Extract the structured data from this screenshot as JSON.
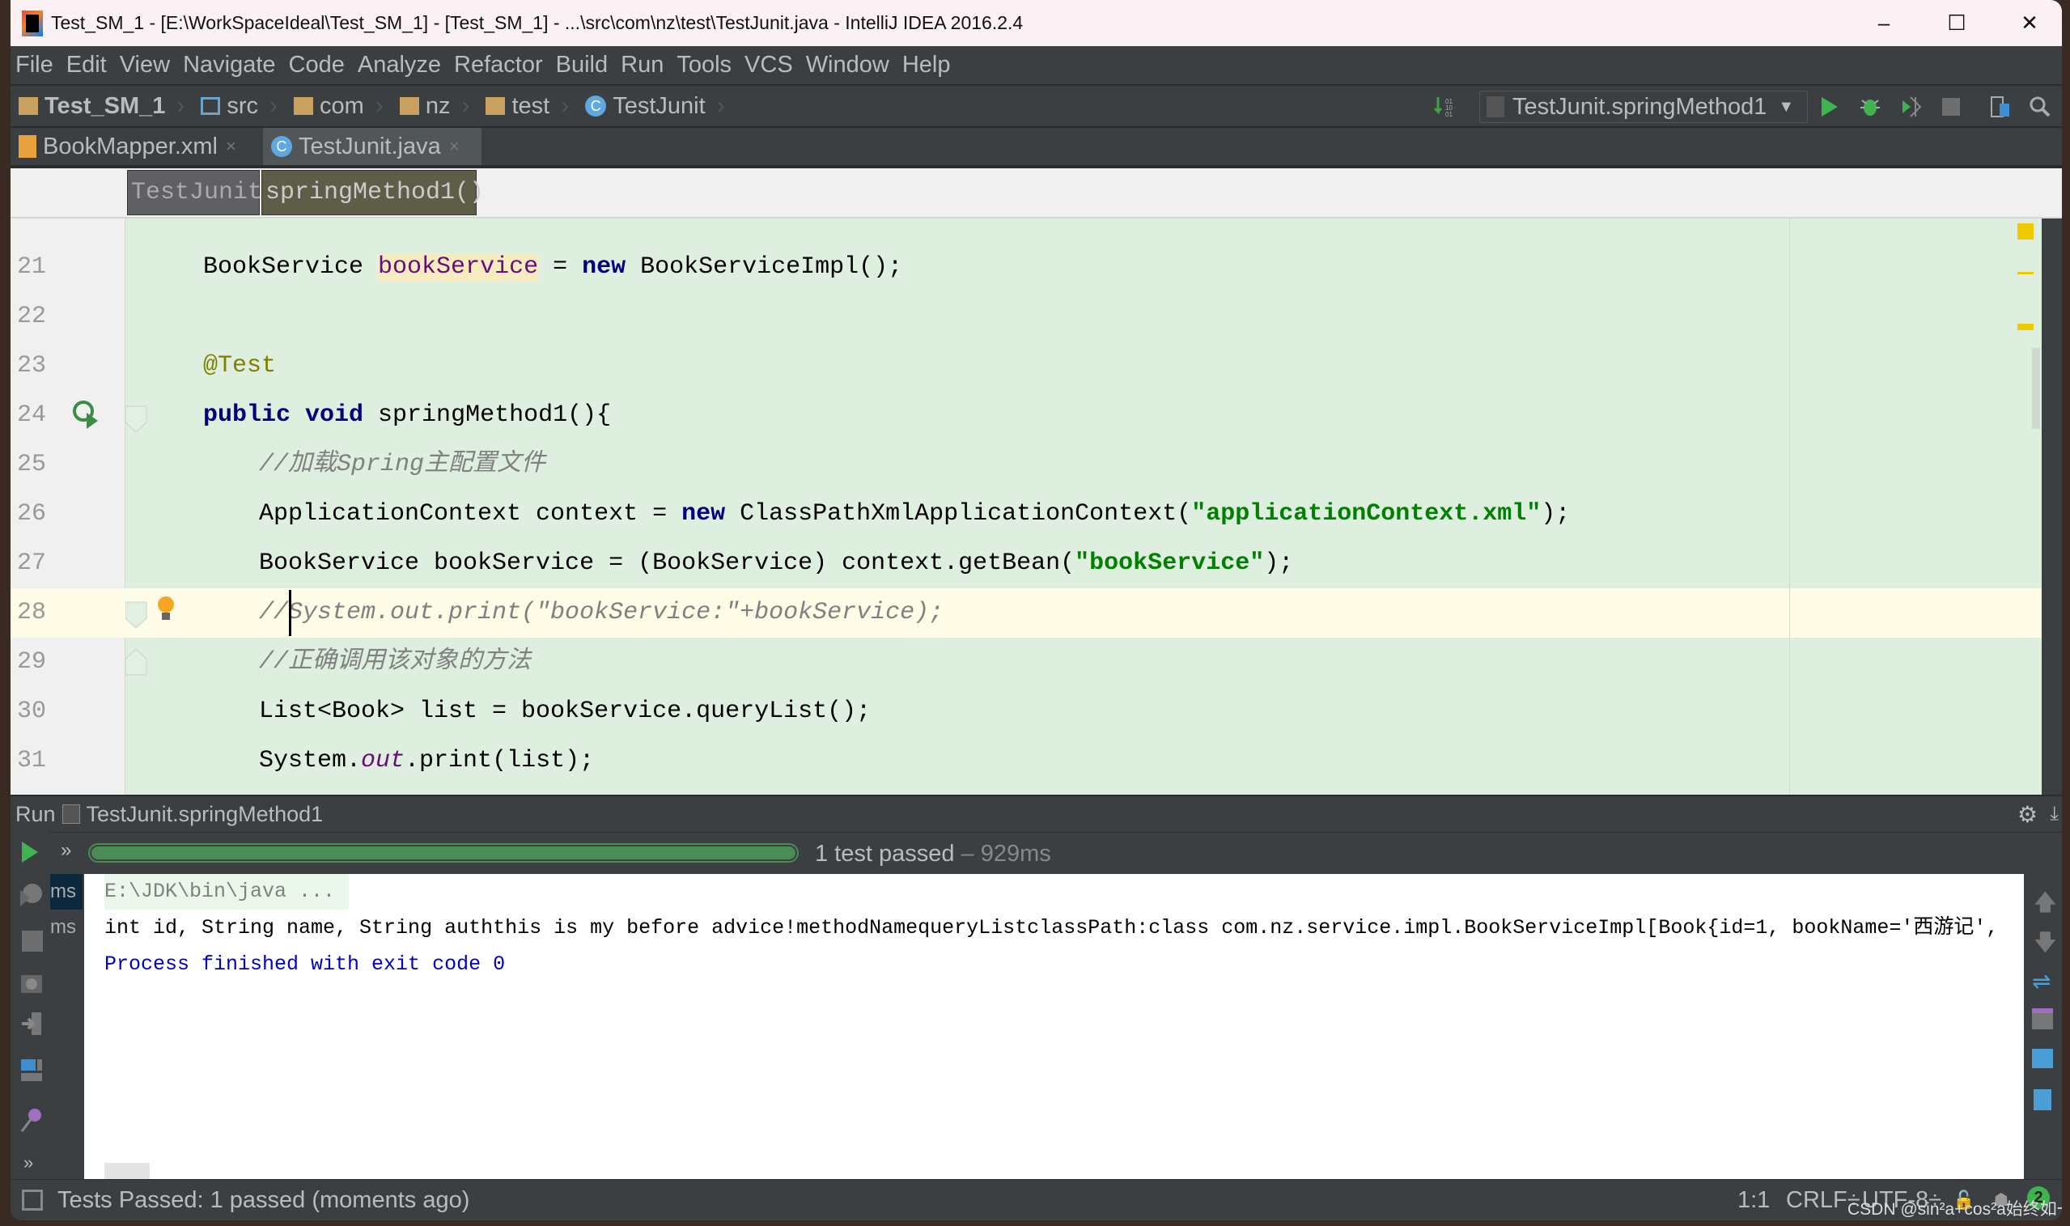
{
  "title": "Test_SM_1 - [E:\\WorkSpaceIdeal\\Test_SM_1] - [Test_SM_1] - ...\\src\\com\\nz\\test\\TestJunit.java - IntelliJ IDEA 2016.2.4",
  "window_controls": {
    "minimize": "–",
    "maximize": "☐",
    "close": "✕"
  },
  "menu": [
    "File",
    "Edit",
    "View",
    "Navigate",
    "Code",
    "Analyze",
    "Refactor",
    "Build",
    "Run",
    "Tools",
    "VCS",
    "Window",
    "Help"
  ],
  "nav": {
    "project": "Test_SM_1",
    "crumbs": [
      "src",
      "com",
      "nz",
      "test"
    ],
    "file": "TestJunit",
    "run_config": "TestJunit.springMethod1"
  },
  "tabs": [
    {
      "label": "BookMapper.xml",
      "icon": "xml-file-icon"
    },
    {
      "label": "TestJunit.java",
      "icon": "java-class-icon",
      "active": true
    }
  ],
  "tab_close": "×",
  "breadcrumb": {
    "cls": "TestJunit",
    "method": "springMethod1()"
  },
  "code": {
    "first_partial_line": "20",
    "lines": [
      {
        "n": "21",
        "indent": 0,
        "tokens": [
          [
            "BookService ",
            "p"
          ],
          [
            "bookService",
            "var"
          ],
          [
            " = ",
            "p"
          ],
          [
            "new",
            "kw"
          ],
          [
            " BookServiceImpl();",
            "p"
          ]
        ]
      },
      {
        "n": "22",
        "indent": 0,
        "tokens": []
      },
      {
        "n": "23",
        "indent": 0,
        "tokens": [
          [
            "@Test",
            "ann"
          ]
        ]
      },
      {
        "n": "24",
        "indent": 0,
        "tokens": [
          [
            "public void",
            "kw"
          ],
          [
            " springMethod1(){",
            "p"
          ]
        ]
      },
      {
        "n": "25",
        "indent": 1,
        "tokens": [
          [
            "//加载Spring主配置文件",
            "cm"
          ]
        ]
      },
      {
        "n": "26",
        "indent": 1,
        "tokens": [
          [
            "ApplicationContext context = ",
            "p"
          ],
          [
            "new",
            "kw"
          ],
          [
            " ClassPathXmlApplicationContext(",
            "p"
          ],
          [
            "\"applicationContext.xml\"",
            "str"
          ],
          [
            ");",
            "p"
          ]
        ]
      },
      {
        "n": "27",
        "indent": 1,
        "tokens": [
          [
            "BookService bookService = (BookService) context.getBean(",
            "p"
          ],
          [
            "\"bookService\"",
            "str"
          ],
          [
            ");",
            "p"
          ]
        ]
      },
      {
        "n": "28",
        "indent": 1,
        "current": true,
        "tokens": [
          [
            "//System.out.print(\"bookService:\"+bookService);",
            "cm"
          ]
        ]
      },
      {
        "n": "29",
        "indent": 1,
        "tokens": [
          [
            "//正确调用该对象的方法",
            "cm"
          ]
        ]
      },
      {
        "n": "30",
        "indent": 1,
        "tokens": [
          [
            "List<Book> list = bookService.queryList();",
            "p"
          ]
        ]
      },
      {
        "n": "31",
        "indent": 1,
        "tokens": [
          [
            "System.",
            "p"
          ],
          [
            "out",
            "fld"
          ],
          [
            ".print(list);",
            "p"
          ]
        ]
      }
    ]
  },
  "run": {
    "label": "Run",
    "config": "TestJunit.springMethod1",
    "progress_percent": 100,
    "result": "1 test passed",
    "duration": " – 929ms",
    "ms_labels": [
      "ms",
      "ms"
    ]
  },
  "console": [
    {
      "text": "E:\\JDK\\bin\\java ...",
      "color": "#808080"
    },
    {
      "text": "int id, String name, String auththis is my before advice!methodNamequeryListclassPath:class com.nz.service.impl.BookServiceImpl[Book{id=1, bookName='西游记',",
      "color": "#000000"
    },
    {
      "text": "Process finished with exit code 0",
      "color": "#0000c0"
    }
  ],
  "status": {
    "message": "Tests Passed: 1 passed (moments ago)",
    "position": "1:1",
    "line_sep": "CRLF÷",
    "encoding": "UTF-8÷",
    "notifications": "2",
    "watermark": "CSDN @sin²a+cos²a始终如一"
  },
  "colors": {
    "editor_bg": "#deeedf",
    "current_line": "#fefbe6",
    "progress": "#4a8c55",
    "dark_ui": "#3c3f41"
  }
}
